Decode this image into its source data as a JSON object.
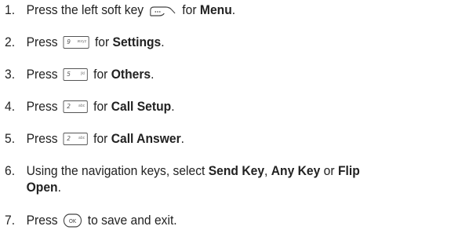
{
  "steps": [
    {
      "num": "1.",
      "pre": "Press the left soft key",
      "mid": "for",
      "bold": "Menu",
      "end": "."
    },
    {
      "num": "2.",
      "pre": "Press",
      "key": {
        "label": "9",
        "sub": "wxyz"
      },
      "mid": "for",
      "bold": "Settings",
      "end": "."
    },
    {
      "num": "3.",
      "pre": "Press",
      "key": {
        "label": "5",
        "sub": "jkl"
      },
      "mid": "for",
      "bold": "Others",
      "end": "."
    },
    {
      "num": "4.",
      "pre": "Press",
      "key": {
        "label": "2",
        "sub": "abc"
      },
      "mid": "for",
      "bold": "Call Setup",
      "end": "."
    },
    {
      "num": "5.",
      "pre": "Press",
      "key": {
        "label": "2",
        "sub": "abc"
      },
      "mid": "for",
      "bold": "Call Answer",
      "end": "."
    },
    {
      "num": "6.",
      "pre": "Using the navigation keys, select",
      "opt1": "Send Key",
      "sep1": ",",
      "opt2": "Any Key",
      "sep2": "or",
      "opt3a": "Flip",
      "opt3b": "Open",
      "end": "."
    },
    {
      "num": "7.",
      "pre": "Press",
      "ok_label": "OK",
      "post": "to save and exit."
    }
  ],
  "icons": {
    "soft_key": "left-soft-key-icon",
    "ok_key": "ok-key-icon"
  }
}
